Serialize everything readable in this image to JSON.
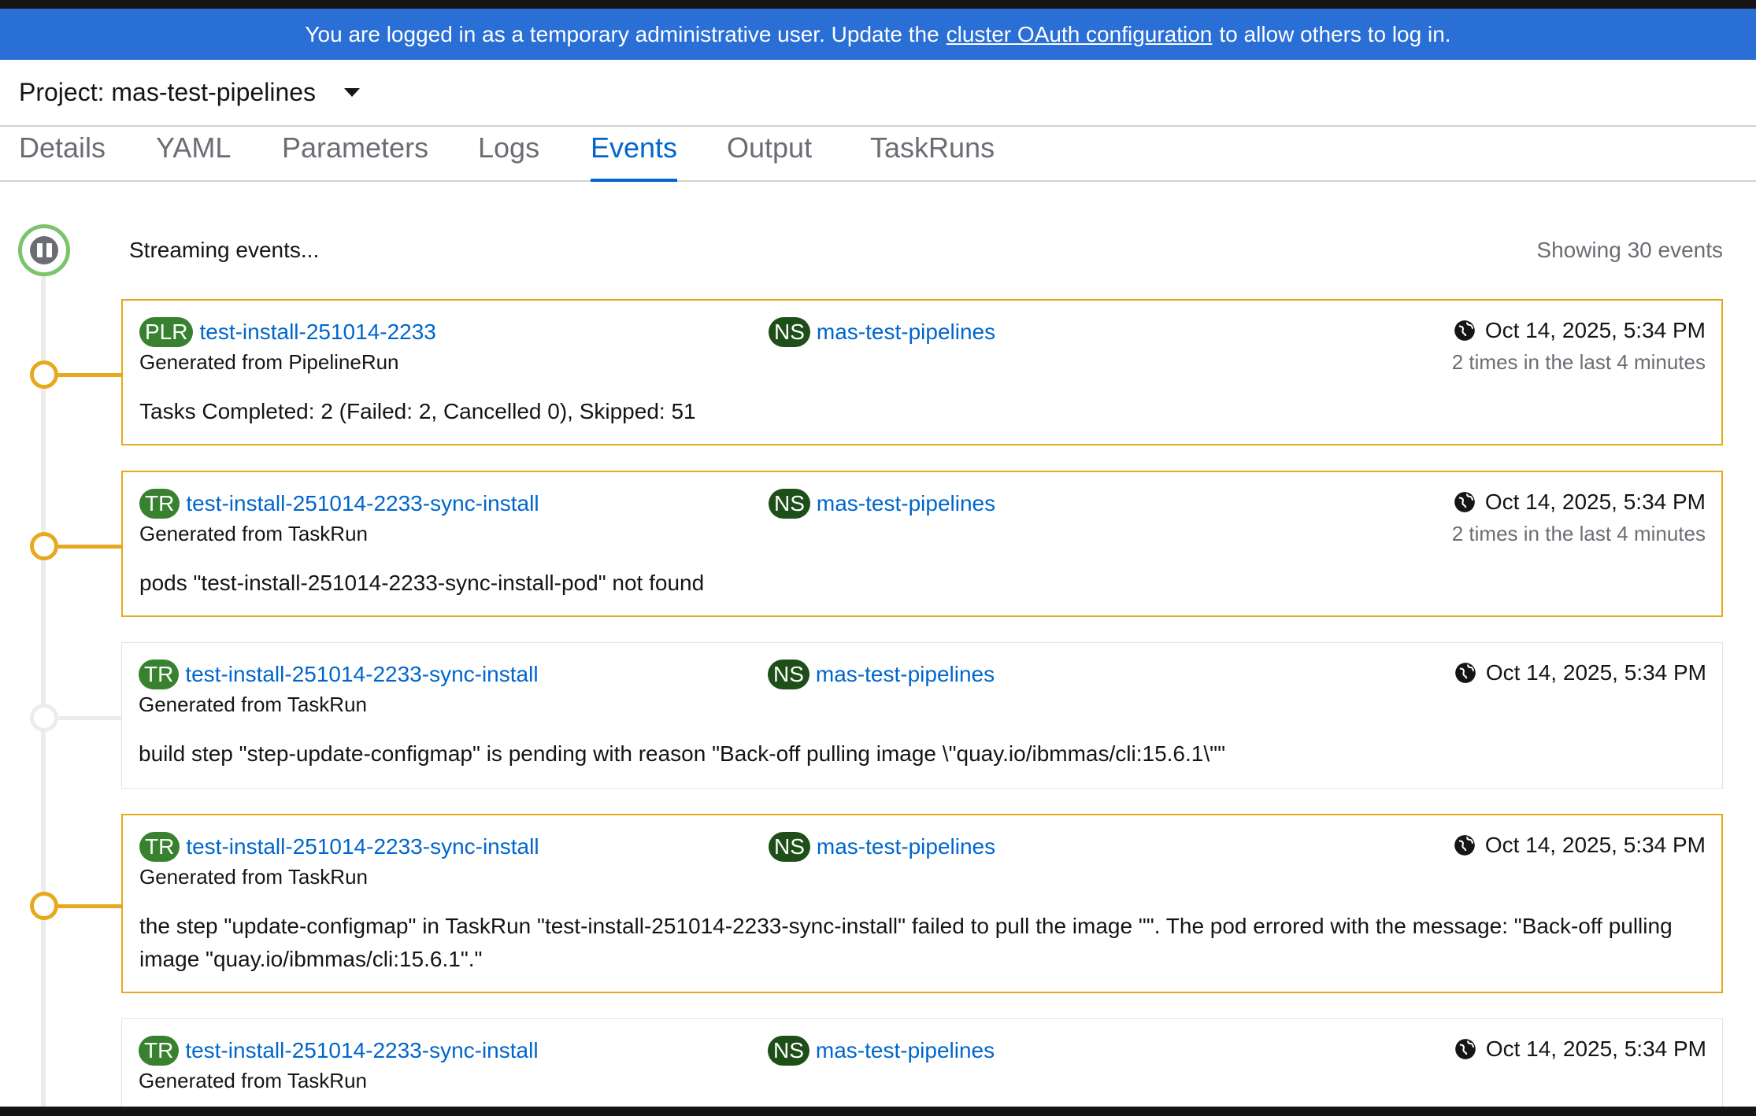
{
  "banner": {
    "text_before": "You are logged in as a temporary administrative user. Update the",
    "link": "cluster OAuth configuration",
    "text_after": "to allow others to log in."
  },
  "project": {
    "label": "Project: mas-test-pipelines"
  },
  "tabs": [
    {
      "label": "Details"
    },
    {
      "label": "YAML"
    },
    {
      "label": "Parameters"
    },
    {
      "label": "Logs"
    },
    {
      "label": "Events",
      "active": true
    },
    {
      "label": "Output"
    },
    {
      "label": "TaskRuns"
    }
  ],
  "events_header": {
    "streaming": "Streaming events...",
    "count": "Showing 30 events"
  },
  "events": [
    {
      "kind_badge": "PLR",
      "name": "test-install-251014-2233",
      "generated": "Generated from PipelineRun",
      "ns_badge": "NS",
      "namespace": "mas-test-pipelines",
      "timestamp": "Oct 14, 2025, 5:34 PM",
      "times": "2 times in the last 4 minutes",
      "message": "Tasks Completed: 2 (Failed: 2, Cancelled 0), Skipped: 51",
      "severity": "warning"
    },
    {
      "kind_badge": "TR",
      "name": "test-install-251014-2233-sync-install",
      "generated": "Generated from TaskRun",
      "ns_badge": "NS",
      "namespace": "mas-test-pipelines",
      "timestamp": "Oct 14, 2025, 5:34 PM",
      "times": "2 times in the last 4 minutes",
      "message": "pods \"test-install-251014-2233-sync-install-pod\" not found",
      "severity": "warning"
    },
    {
      "kind_badge": "TR",
      "name": "test-install-251014-2233-sync-install",
      "generated": "Generated from TaskRun",
      "ns_badge": "NS",
      "namespace": "mas-test-pipelines",
      "timestamp": "Oct 14, 2025, 5:34 PM",
      "message": "build step \"step-update-configmap\" is pending with reason \"Back-off pulling image \\\"quay.io/ibmmas/cli:15.6.1\\\"\"",
      "severity": "normal"
    },
    {
      "kind_badge": "TR",
      "name": "test-install-251014-2233-sync-install",
      "generated": "Generated from TaskRun",
      "ns_badge": "NS",
      "namespace": "mas-test-pipelines",
      "timestamp": "Oct 14, 2025, 5:34 PM",
      "message": "the step \"update-configmap\" in TaskRun \"test-install-251014-2233-sync-install\" failed to pull the image \"\". The pod errored with the message: \"Back-off pulling image \"quay.io/ibmmas/cli:15.6.1\".\"",
      "severity": "warning"
    },
    {
      "kind_badge": "TR",
      "name": "test-install-251014-2233-sync-install",
      "generated": "Generated from TaskRun",
      "ns_badge": "NS",
      "namespace": "mas-test-pipelines",
      "timestamp": "Oct 14, 2025, 5:34 PM",
      "severity": "normal"
    }
  ],
  "icons": {
    "project_dropdown": "caret-down-icon",
    "pause": "pause-icon",
    "timestamp": "globe-icon"
  },
  "colors": {
    "banner": "#2a6fd6",
    "warning": "#e6a91e",
    "link": "#0066cc",
    "badge": "#38812f",
    "ns_badge": "#1e4f18",
    "pause_ring": "#7cc36b"
  }
}
